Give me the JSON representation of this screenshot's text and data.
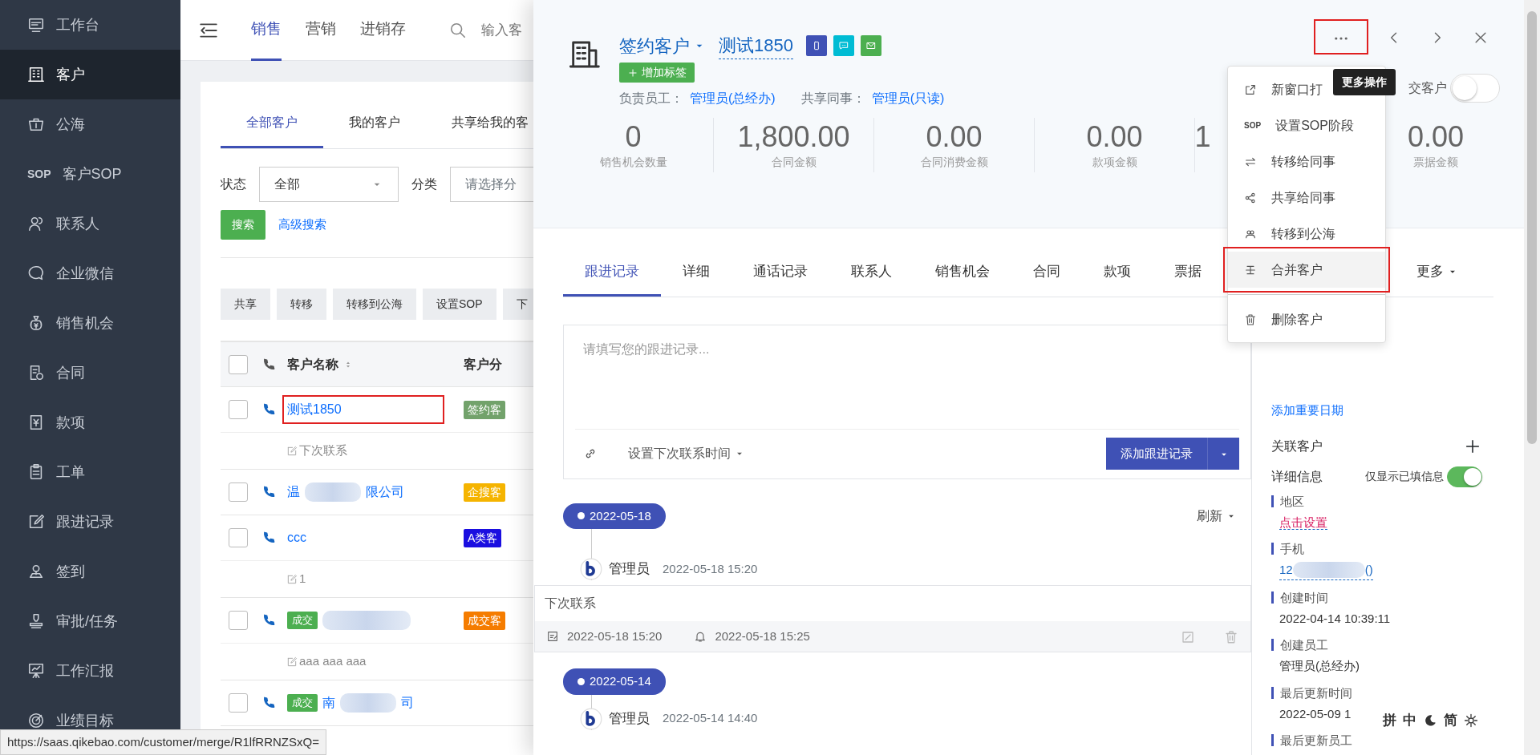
{
  "sidebar": {
    "items": [
      {
        "label": "工作台",
        "selected": false
      },
      {
        "label": "客户",
        "selected": true
      },
      {
        "label": "公海",
        "selected": false
      },
      {
        "label": "客户SOP",
        "selected": false,
        "icon_text": "SOP"
      },
      {
        "label": "联系人",
        "selected": false
      },
      {
        "label": "企业微信",
        "selected": false
      },
      {
        "label": "销售机会",
        "selected": false
      },
      {
        "label": "合同",
        "selected": false
      },
      {
        "label": "款项",
        "selected": false
      },
      {
        "label": "工单",
        "selected": false
      },
      {
        "label": "跟进记录",
        "selected": false
      },
      {
        "label": "签到",
        "selected": false
      },
      {
        "label": "审批/任务",
        "selected": false
      },
      {
        "label": "工作汇报",
        "selected": false
      },
      {
        "label": "业绩目标",
        "selected": false
      }
    ]
  },
  "topnav": {
    "tabs": [
      {
        "label": "销售",
        "selected": true
      },
      {
        "label": "营销",
        "selected": false
      },
      {
        "label": "进销存",
        "selected": false
      }
    ],
    "search": {
      "placeholder": "输入客"
    }
  },
  "customer_list": {
    "tabs": [
      {
        "label": "全部客户",
        "selected": true
      },
      {
        "label": "我的客户",
        "selected": false
      },
      {
        "label": "共享给我的客",
        "selected": false
      }
    ],
    "filters": {
      "status_label": "状态",
      "status_value": "全部",
      "category_label": "分类",
      "category_placeholder": "请选择分"
    },
    "search_button": "搜索",
    "advanced_search": "高级搜索",
    "actions": [
      "共享",
      "转移",
      "转移到公海",
      "设置SOP",
      "下"
    ],
    "columns": [
      "客户名称",
      "客户分"
    ],
    "select_all_checked": false,
    "rows": [
      {
        "checked": false,
        "name_parts": [
          "测试1850"
        ],
        "blurred": false,
        "highlighted": true,
        "category": {
          "label": "签约客",
          "color": "#72a26b"
        },
        "note": "下次联系"
      },
      {
        "checked": false,
        "name_parts": [
          "温",
          "限公司"
        ],
        "blurred": true,
        "highlighted": false,
        "category": {
          "label": "企搜客",
          "color": "#f5b400"
        }
      },
      {
        "checked": false,
        "name_parts": [
          "ccc"
        ],
        "blurred": false,
        "highlighted": false,
        "category": {
          "label": "A类客",
          "color": "#1a0ee0"
        },
        "note": "1"
      },
      {
        "checked": false,
        "deal_tag": "成交",
        "blurred": true,
        "highlighted": false,
        "category": {
          "label": "成交客",
          "color": "#f57c00"
        },
        "note": "aaa aaa aaa"
      },
      {
        "checked": false,
        "deal_tag": "成交",
        "name_parts": [
          "南",
          "司"
        ],
        "blurred": true,
        "highlighted": false
      }
    ]
  },
  "drawer": {
    "header": {
      "status_dropdown": "签约客户",
      "name": "测试1850",
      "contact_buttons": [
        {
          "kind": "phone"
        },
        {
          "kind": "chat"
        },
        {
          "kind": "email"
        }
      ],
      "add_tag": "增加标签",
      "owner_label": "负责员工：",
      "owner": "管理员(总经办)",
      "shared_label": "共享同事：",
      "shared": "管理员(只读)",
      "deal_toggle": {
        "label": "交客户",
        "on": false
      },
      "more_highlighted": true
    },
    "stats": [
      {
        "value": "0",
        "label": "销售机会数量"
      },
      {
        "value": "1,800.00",
        "label": "合同金额"
      },
      {
        "value": "0.00",
        "label": "合同消费金额"
      },
      {
        "value": "0.00",
        "label": "款项金额"
      },
      {
        "value": "1"
      },
      {
        "value": "0.00",
        "label": "票据金额"
      }
    ],
    "tabs": [
      {
        "label": "跟进记录",
        "selected": true
      },
      {
        "label": "详细",
        "selected": false
      },
      {
        "label": "通话记录",
        "selected": false
      },
      {
        "label": "联系人",
        "selected": false
      },
      {
        "label": "销售机会",
        "selected": false
      },
      {
        "label": "合同",
        "selected": false
      },
      {
        "label": "款项",
        "selected": false
      },
      {
        "label": "票据",
        "selected": false
      }
    ],
    "more_tab": "更多",
    "editor": {
      "placeholder": "请填写您的跟进记录...",
      "next_contact": "设置下次联系时间",
      "submit": "添加跟进记录"
    },
    "refresh": "刷新",
    "timeline": [
      {
        "date": "2022-05-18",
        "entries": [
          {
            "author": "管理员",
            "time": "2022-05-18 15:20",
            "content": "下次联系",
            "created": "2022-05-18 15:20",
            "remind": "2022-05-18 15:25"
          }
        ]
      },
      {
        "date": "2022-05-14",
        "entries": [
          {
            "author": "管理员",
            "time": "2022-05-14 14:40"
          }
        ]
      }
    ],
    "side": {
      "add_date": "添加重要日期",
      "related": "关联客户",
      "details_title": "详细信息",
      "filled_only": {
        "label": "仅显示已填信息",
        "on": true
      },
      "fields": [
        {
          "label": "地区",
          "value": "点击设置",
          "kind": "set-link"
        },
        {
          "label": "手机",
          "value": "12",
          "suffix": "()",
          "kind": "phone"
        },
        {
          "label": "创建时间",
          "value": "2022-04-14 10:39:11",
          "kind": "text"
        },
        {
          "label": "创建员工",
          "value": "管理员(总经办)",
          "kind": "text"
        },
        {
          "label": "最后更新时间",
          "value": "2022-05-09 1",
          "kind": "text"
        },
        {
          "label": "最后更新员工"
        }
      ]
    },
    "more_menu": [
      {
        "label": "新窗口打",
        "kind": "open",
        "hovered": false,
        "highlighted": false
      },
      {
        "label": "设置SOP阶段",
        "kind": "sop",
        "icon_text": "SOP",
        "hovered": false,
        "highlighted": false
      },
      {
        "label": "转移给同事",
        "kind": "transfer",
        "hovered": false,
        "highlighted": false
      },
      {
        "label": "共享给同事",
        "kind": "share",
        "hovered": false,
        "highlighted": false
      },
      {
        "label": "转移到公海",
        "kind": "pool",
        "hovered": false,
        "highlighted": false
      },
      {
        "label": "合并客户",
        "kind": "merge",
        "hovered": true,
        "highlighted": true
      },
      {
        "label": "删除客户",
        "kind": "delete",
        "hovered": false,
        "highlighted": false
      }
    ],
    "tooltip": "更多操作"
  },
  "status_url": "https://saas.qikebao.com/customer/merge/R1lfRRNZSxQ=",
  "ime_bar": [
    "拼",
    "中",
    "简"
  ]
}
